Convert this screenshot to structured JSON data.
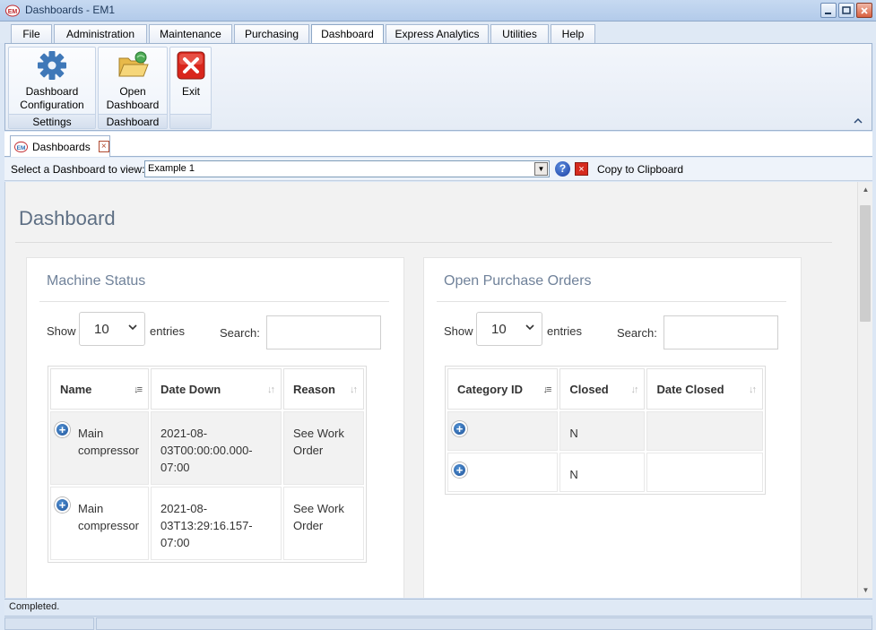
{
  "window": {
    "title": "Dashboards - EM1",
    "app_icon_label": "EM"
  },
  "menu_tabs": [
    {
      "label": "File"
    },
    {
      "label": "Administration"
    },
    {
      "label": "Maintenance"
    },
    {
      "label": "Purchasing"
    },
    {
      "label": "Dashboard",
      "active": true
    },
    {
      "label": "Express Analytics"
    },
    {
      "label": "Utilities"
    },
    {
      "label": "Help"
    }
  ],
  "ribbon": {
    "groups": [
      {
        "label": "Settings",
        "button": {
          "line1": "Dashboard",
          "line2": "Configuration",
          "icon": "gear-icon"
        }
      },
      {
        "label": "Dashboard",
        "button": {
          "line1": "Open",
          "line2": "Dashboard",
          "icon": "open-folder-icon"
        }
      },
      {
        "label": "",
        "button": {
          "line1": "Exit",
          "line2": "",
          "icon": "exit-icon"
        }
      }
    ]
  },
  "doc_tab": {
    "label": "Dashboards",
    "close_glyph": "×"
  },
  "selector": {
    "label": "Select a Dashboard to view:",
    "value": "Example 1",
    "copy_label": "Copy to Clipboard",
    "help_glyph": "?",
    "close_glyph": "×"
  },
  "page": {
    "title": "Dashboard"
  },
  "panels": {
    "machine_status": {
      "title": "Machine Status",
      "show_label": "Show",
      "entries_value": "10",
      "entries_label": "entries",
      "search_label": "Search:",
      "columns": [
        "Name",
        "Date Down",
        "Reason"
      ],
      "rows": [
        {
          "name": "Main compressor",
          "date_down": "2021-08-03T00:00:00.000-07:00",
          "reason": "See Work Order"
        },
        {
          "name": "Main compressor",
          "date_down": "2021-08-03T13:29:16.157-07:00",
          "reason": "See Work Order"
        }
      ]
    },
    "open_purchase_orders": {
      "title": "Open Purchase Orders",
      "show_label": "Show",
      "entries_value": "10",
      "entries_label": "entries",
      "search_label": "Search:",
      "columns": [
        "Category ID",
        "Closed",
        "Date Closed"
      ],
      "rows": [
        {
          "category_id": "",
          "closed": "N",
          "date_closed": ""
        },
        {
          "category_id": "",
          "closed": "N",
          "date_closed": ""
        }
      ]
    }
  },
  "status": {
    "text": "Completed."
  },
  "colors": {
    "accent": "#2f6fb5",
    "title_bar": "#c6d9f1",
    "panel_title": "#70829a"
  }
}
